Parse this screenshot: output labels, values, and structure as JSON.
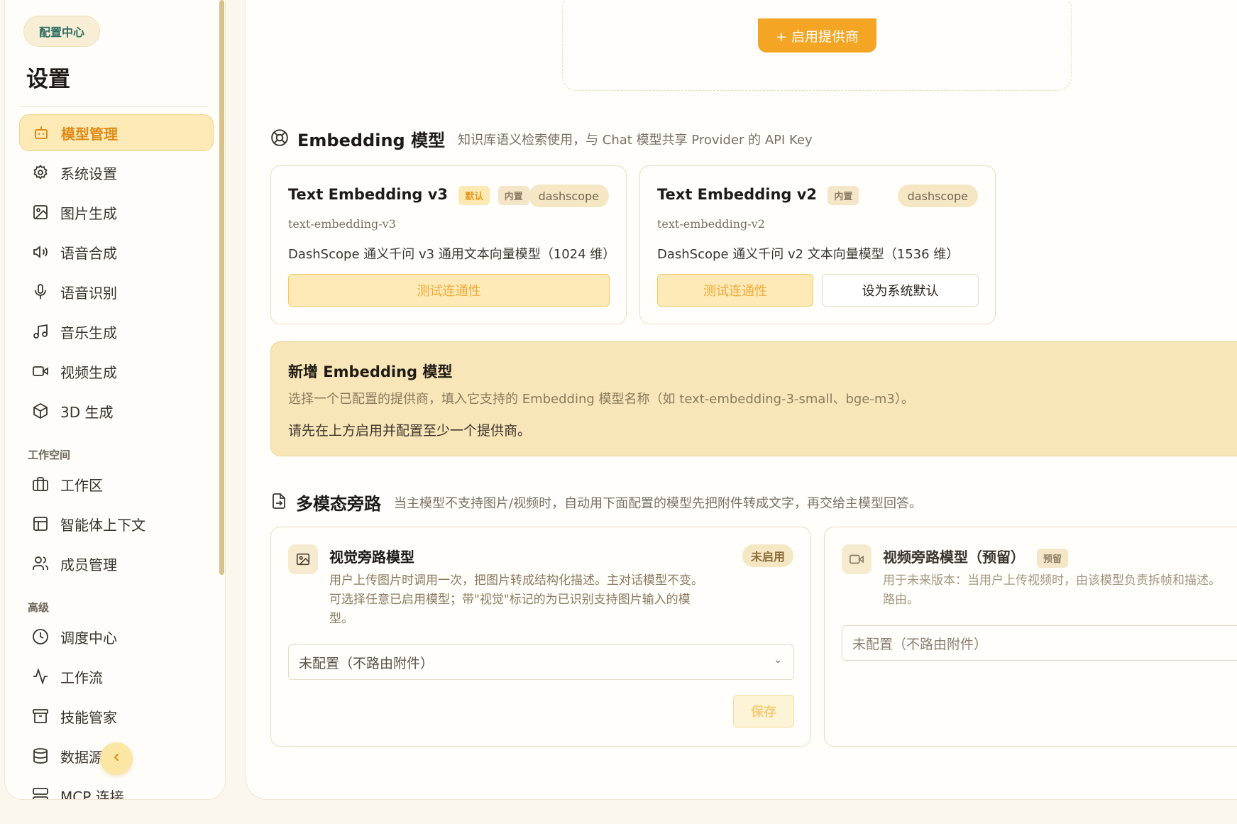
{
  "sidebar": {
    "badge": "配置中心",
    "title": "设置",
    "items": [
      {
        "label": "模型管理",
        "icon": "robot-icon",
        "active": true
      },
      {
        "label": "系统设置",
        "icon": "gear-icon"
      },
      {
        "label": "图片生成",
        "icon": "image-icon"
      },
      {
        "label": "语音合成",
        "icon": "speaker-icon"
      },
      {
        "label": "语音识别",
        "icon": "microphone-icon"
      },
      {
        "label": "音乐生成",
        "icon": "music-note-icon"
      },
      {
        "label": "视频生成",
        "icon": "video-camera-icon"
      },
      {
        "label": "3D 生成",
        "icon": "cube-icon"
      }
    ],
    "section_workspace": "工作空间",
    "workspace_items": [
      {
        "label": "工作区",
        "icon": "briefcase-icon"
      },
      {
        "label": "智能体上下文",
        "icon": "layout-icon"
      },
      {
        "label": "成员管理",
        "icon": "users-icon"
      }
    ],
    "section_advanced": "高级",
    "advanced_items": [
      {
        "label": "调度中心",
        "icon": "clock-icon"
      },
      {
        "label": "工作流",
        "icon": "activity-icon"
      },
      {
        "label": "技能管家",
        "icon": "archive-icon"
      },
      {
        "label": "数据源",
        "icon": "database-icon"
      },
      {
        "label": "MCP 连接",
        "icon": "server-icon"
      }
    ]
  },
  "providers": {
    "enable_button": "+ 启用提供商"
  },
  "embedding": {
    "title": "Embedding 模型",
    "description": "知识库语义检索使用，与 Chat 模型共享 Provider 的 API Key",
    "cards": [
      {
        "name": "Text Embedding v3",
        "tag_default": "默认",
        "tag_builtin": "内置",
        "provider": "dashscope",
        "model_id": "text-embedding-v3",
        "desc": "DashScope 通义千问 v3 通用文本向量模型（1024 维）",
        "test_button": "测试连通性"
      },
      {
        "name": "Text Embedding v2",
        "tag_builtin": "内置",
        "provider": "dashscope",
        "model_id": "text-embedding-v2",
        "desc": "DashScope 通义千问 v2 文本向量模型（1536 维）",
        "test_button": "测试连通性",
        "set_default_button": "设为系统默认"
      }
    ],
    "add_panel": {
      "title": "新增 Embedding 模型",
      "desc": "选择一个已配置的提供商，填入它支持的 Embedding 模型名称（如 text-embedding-3-small、bge-m3）。",
      "notice": "请先在上方启用并配置至少一个提供商。"
    }
  },
  "multimodal": {
    "title": "多模态旁路",
    "description": "当主模型不支持图片/视频时，自动用下面配置的模型先把附件转成文字，再交给主模型回答。",
    "vision": {
      "title": "视觉旁路模型",
      "status": "未启用",
      "desc_line1": "用户上传图片时调用一次，把图片转成结构化描述。主对话模型不变。",
      "desc_line2": "可选择任意已启用模型；带\"视觉\"标记的为已识别支持图片输入的模",
      "desc_line3": "型。",
      "select_value": "未配置（不路由附件）",
      "save_button": "保存"
    },
    "video": {
      "title": "视频旁路模型（预留）",
      "tag": "预留",
      "desc_line1": "用于未来版本：当用户上传视频时，由该模型负责拆帧和描述。",
      "desc_line2": "路由。",
      "select_value": "未配置（不路由附件）"
    }
  },
  "colors": {
    "accent": "#f5a524",
    "active_bg": "#fdeab7",
    "panel_bg": "#f8e6b8"
  }
}
